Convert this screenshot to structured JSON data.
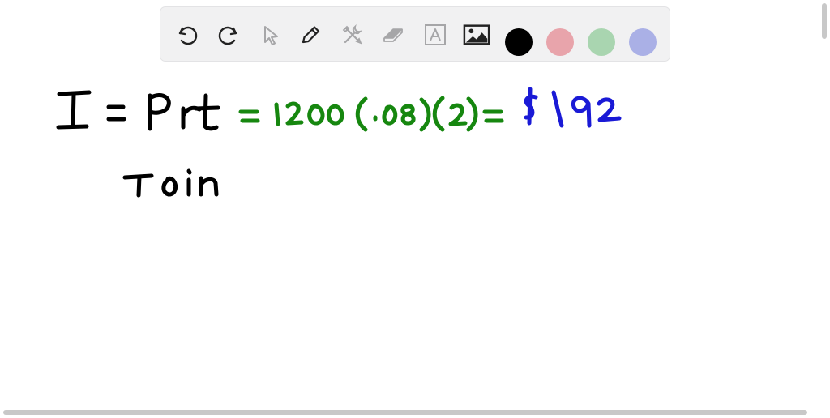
{
  "toolbar": {
    "tools": [
      {
        "name": "undo-icon"
      },
      {
        "name": "redo-icon"
      },
      {
        "name": "pointer-icon"
      },
      {
        "name": "pencil-icon"
      },
      {
        "name": "tools-icon"
      },
      {
        "name": "eraser-icon"
      },
      {
        "name": "text-icon"
      },
      {
        "name": "image-icon"
      }
    ],
    "colors": [
      {
        "name": "black",
        "hex": "#000000",
        "selected": true
      },
      {
        "name": "red",
        "hex": "#e8a4ab",
        "selected": false
      },
      {
        "name": "green",
        "hex": "#a9d5b0",
        "selected": false
      },
      {
        "name": "blue",
        "hex": "#aab0e6",
        "selected": false
      }
    ]
  },
  "handwriting": {
    "line1_black": "I = Prt",
    "line1_green": "= 1200(.08)(2) =",
    "line1_blue": "$192",
    "line2_black": "T0in",
    "colors": {
      "black": "#000000",
      "green": "#16870f",
      "blue": "#1a1ad6"
    }
  }
}
